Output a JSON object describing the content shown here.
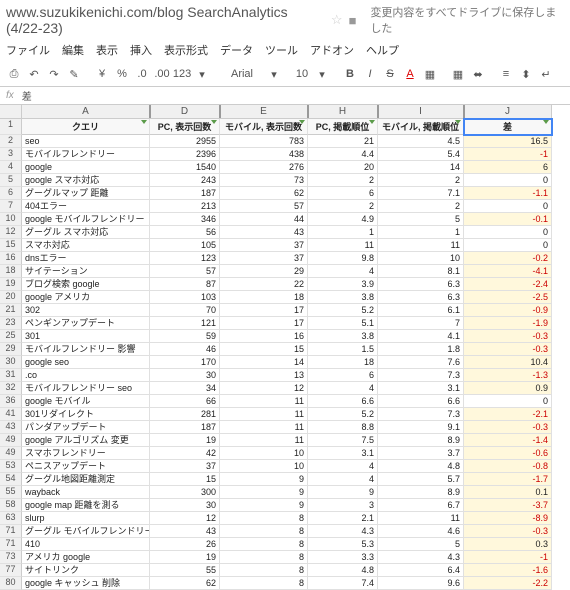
{
  "doc": {
    "title": "www.suzukikenichi.com/blog SearchAnalytics (4/22-23)",
    "saveNote": "変更内容をすべてドライブに保存しました"
  },
  "menu": [
    "ファイル",
    "編集",
    "表示",
    "挿入",
    "表示形式",
    "データ",
    "ツール",
    "アドオン",
    "ヘルプ"
  ],
  "toolbar": {
    "font": "Arial",
    "size": "10",
    "zoom": "123"
  },
  "fx": {
    "label": "fx",
    "value": "差"
  },
  "cols": [
    "A",
    "D",
    "E",
    "H",
    "I",
    "J"
  ],
  "headers": [
    "クエリ",
    "PC, 表示回数",
    "モバイル, 表示回数",
    "PC, 掲載順位",
    "モバイル, 掲載順位",
    "差"
  ],
  "rows": [
    {
      "n": 2,
      "q": "seo",
      "d": 2955,
      "e": 783,
      "h": 21,
      "i": 4.5,
      "j": 16.5
    },
    {
      "n": 3,
      "q": "モバイルフレンドリー",
      "d": 2396,
      "e": 438,
      "h": 4.4,
      "i": 5.4,
      "j": -1
    },
    {
      "n": 4,
      "q": "google",
      "d": 1540,
      "e": 276,
      "h": 20,
      "i": 14,
      "j": 6
    },
    {
      "n": 5,
      "q": "google スマホ対応",
      "d": 243,
      "e": 73,
      "h": 2,
      "i": 2,
      "j": 0
    },
    {
      "n": 6,
      "q": "グーグルマップ 距離",
      "d": 187,
      "e": 62,
      "h": 6,
      "i": 7.1,
      "j": -1.1
    },
    {
      "n": 7,
      "q": "404エラー",
      "d": 213,
      "e": 57,
      "h": 2,
      "i": 2,
      "j": 0
    },
    {
      "n": 10,
      "q": "google モバイルフレンドリー",
      "d": 346,
      "e": 44,
      "h": 4.9,
      "i": 5,
      "j": -0.1
    },
    {
      "n": 12,
      "q": "グーグル スマホ対応",
      "d": 56,
      "e": 43,
      "h": 1,
      "i": 1,
      "j": 0
    },
    {
      "n": 15,
      "q": "スマホ対応",
      "d": 105,
      "e": 37,
      "h": 11,
      "i": 11,
      "j": 0
    },
    {
      "n": 16,
      "q": "dnsエラー",
      "d": 123,
      "e": 37,
      "h": 9.8,
      "i": 10,
      "j": -0.2
    },
    {
      "n": 18,
      "q": "サイテーション",
      "d": 57,
      "e": 29,
      "h": 4,
      "i": 8.1,
      "j": -4.1
    },
    {
      "n": 19,
      "q": "ブログ検索 google",
      "d": 87,
      "e": 22,
      "h": 3.9,
      "i": 6.3,
      "j": -2.4
    },
    {
      "n": 20,
      "q": "google アメリカ",
      "d": 103,
      "e": 18,
      "h": 3.8,
      "i": 6.3,
      "j": -2.5
    },
    {
      "n": 21,
      "q": "302",
      "d": 70,
      "e": 17,
      "h": 5.2,
      "i": 6.1,
      "j": -0.9
    },
    {
      "n": 23,
      "q": "ペンギンアップデート",
      "d": 121,
      "e": 17,
      "h": 5.1,
      "i": 7,
      "j": -1.9
    },
    {
      "n": 25,
      "q": "301",
      "d": 59,
      "e": 16,
      "h": 3.8,
      "i": 4.1,
      "j": -0.3
    },
    {
      "n": 29,
      "q": "モバイルフレンドリー 影響",
      "d": 46,
      "e": 15,
      "h": 1.5,
      "i": 1.8,
      "j": -0.3
    },
    {
      "n": 30,
      "q": "google seo",
      "d": 170,
      "e": 14,
      "h": 18,
      "i": 7.6,
      "j": 10.4
    },
    {
      "n": 31,
      "q": ".co",
      "d": 30,
      "e": 13,
      "h": 6,
      "i": 7.3,
      "j": -1.3
    },
    {
      "n": 32,
      "q": "モバイルフレンドリー seo",
      "d": 34,
      "e": 12,
      "h": 4,
      "i": 3.1,
      "j": 0.9
    },
    {
      "n": 36,
      "q": "google モバイル",
      "d": 66,
      "e": 11,
      "h": 6.6,
      "i": 6.6,
      "j": 0
    },
    {
      "n": 41,
      "q": "301リダイレクト",
      "d": 281,
      "e": 11,
      "h": 5.2,
      "i": 7.3,
      "j": -2.1
    },
    {
      "n": 43,
      "q": "パンダアップデート",
      "d": 187,
      "e": 11,
      "h": 8.8,
      "i": 9.1,
      "j": -0.3
    },
    {
      "n": 49,
      "q": "google アルゴリズム 変更",
      "d": 19,
      "e": 11,
      "h": 7.5,
      "i": 8.9,
      "j": -1.4
    },
    {
      "n": 49,
      "q": "スマホフレンドリー",
      "d": 42,
      "e": 10,
      "h": 3.1,
      "i": 3.7,
      "j": -0.6
    },
    {
      "n": 53,
      "q": "ペニスアップデート",
      "d": 37,
      "e": 10,
      "h": 4,
      "i": 4.8,
      "j": -0.8
    },
    {
      "n": 54,
      "q": "グーグル地図距離測定",
      "d": 15,
      "e": 9,
      "h": 4,
      "i": 5.7,
      "j": -1.7
    },
    {
      "n": 55,
      "q": "wayback",
      "d": 300,
      "e": 9,
      "h": 9,
      "i": 8.9,
      "j": 0.1
    },
    {
      "n": 58,
      "q": "google map 距離を測る",
      "d": 30,
      "e": 9,
      "h": 3,
      "i": 6.7,
      "j": -3.7
    },
    {
      "n": 63,
      "q": "slurp",
      "d": 12,
      "e": 8,
      "h": 2.1,
      "i": 11,
      "j": -8.9
    },
    {
      "n": 71,
      "q": "グーグル モバイルフレンドリー",
      "d": 43,
      "e": 8,
      "h": 4.3,
      "i": 4.6,
      "j": -0.3
    },
    {
      "n": 71,
      "q": "410",
      "d": 26,
      "e": 8,
      "h": 5.3,
      "i": 5,
      "j": 0.3
    },
    {
      "n": 73,
      "q": "アメリカ google",
      "d": 19,
      "e": 8,
      "h": 3.3,
      "i": 4.3,
      "j": -1
    },
    {
      "n": 77,
      "q": "サイトリンク",
      "d": 55,
      "e": 8,
      "h": 4.8,
      "i": 6.4,
      "j": -1.6
    },
    {
      "n": 80,
      "q": "google キャッシュ 削除",
      "d": 62,
      "e": 8,
      "h": 7.4,
      "i": 9.6,
      "j": -2.2
    }
  ]
}
